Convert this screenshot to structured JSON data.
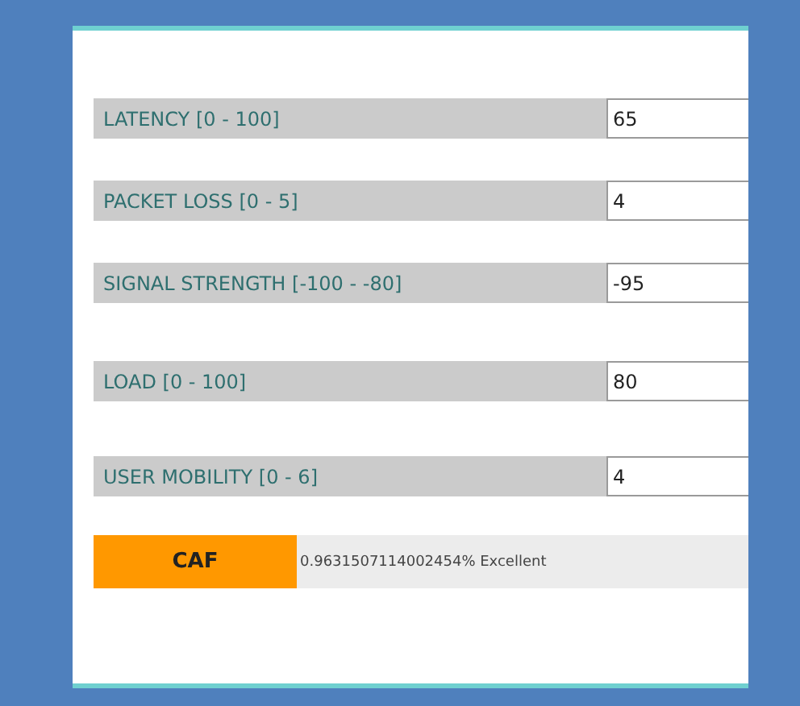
{
  "fields": [
    {
      "label": "LATENCY [0 - 100]",
      "value": "65"
    },
    {
      "label": "PACKET LOSS [0 - 5]",
      "value": "4"
    },
    {
      "label": "SIGNAL STRENGTH [-100 - -80]",
      "value": "-95"
    },
    {
      "label": "LOAD [0 - 100]",
      "value": "80"
    },
    {
      "label": "USER MOBILITY [0 - 6]",
      "value": "4"
    }
  ],
  "result": {
    "button": "CAF",
    "text": "0.9631507114002454% Excellent"
  }
}
